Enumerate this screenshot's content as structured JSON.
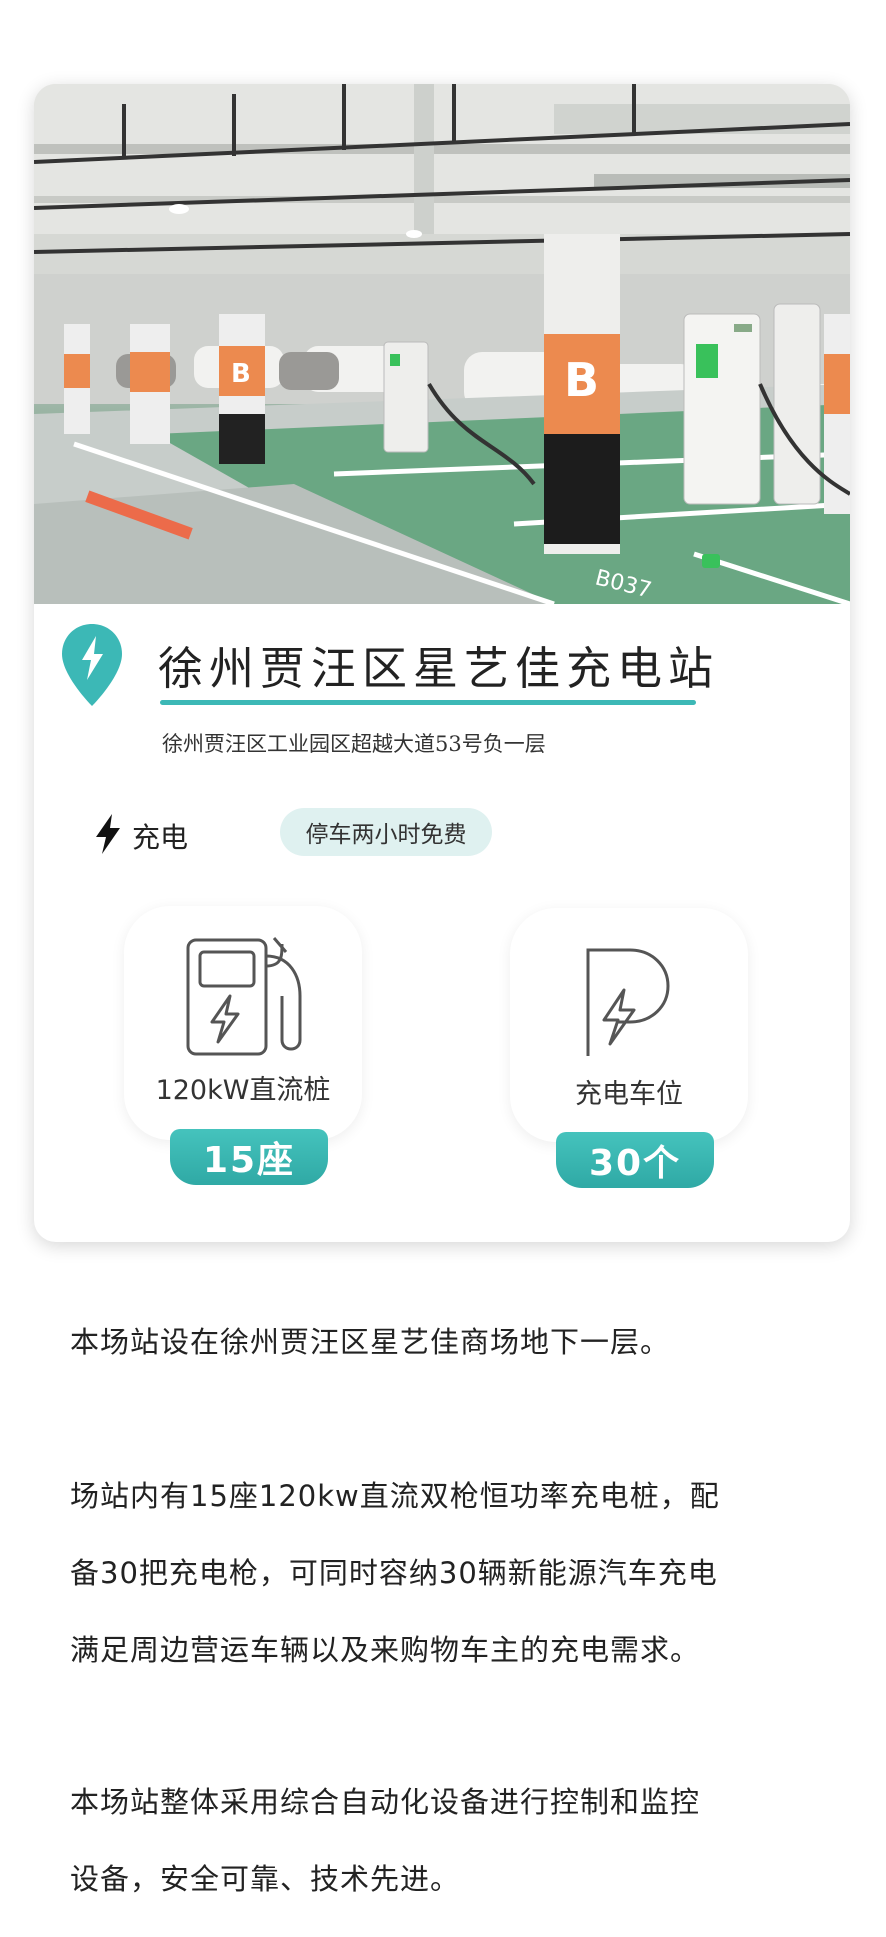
{
  "station": {
    "name": "徐州贾汪区星艺佳充电站",
    "address": "徐州贾汪区工业园区超越大道53号负一层",
    "charge_label": "充电",
    "parking_badge": "停车两小时免费"
  },
  "features": [
    {
      "icon": "dc-charger-icon",
      "label": "120kW直流桩",
      "count": "15座"
    },
    {
      "icon": "parking-charge-icon",
      "label": "充电车位",
      "count": "30个"
    }
  ],
  "photo": {
    "pillar_sign": "B",
    "floor_marking": "B037"
  },
  "description": {
    "p1": [
      "本场站设在徐州贾汪区星艺佳商场地下一层。"
    ],
    "p2": [
      "场站内有15座120kw直流双枪恒功率充电桩，配",
      "备30把充电枪，可同时容纳30辆新能源汽车充电",
      "满足周边营运车辆以及来购物车主的充电需求。"
    ],
    "p3": [
      "本场站整体采用综合自动化设备进行控制和监控",
      "设备，安全可靠、技术先进。"
    ]
  },
  "colors": {
    "accent": "#3cb8b6",
    "badge_bg": "#dff1f0",
    "pillar_orange": "#ec8a4f",
    "floor_green": "#5e9c78"
  }
}
